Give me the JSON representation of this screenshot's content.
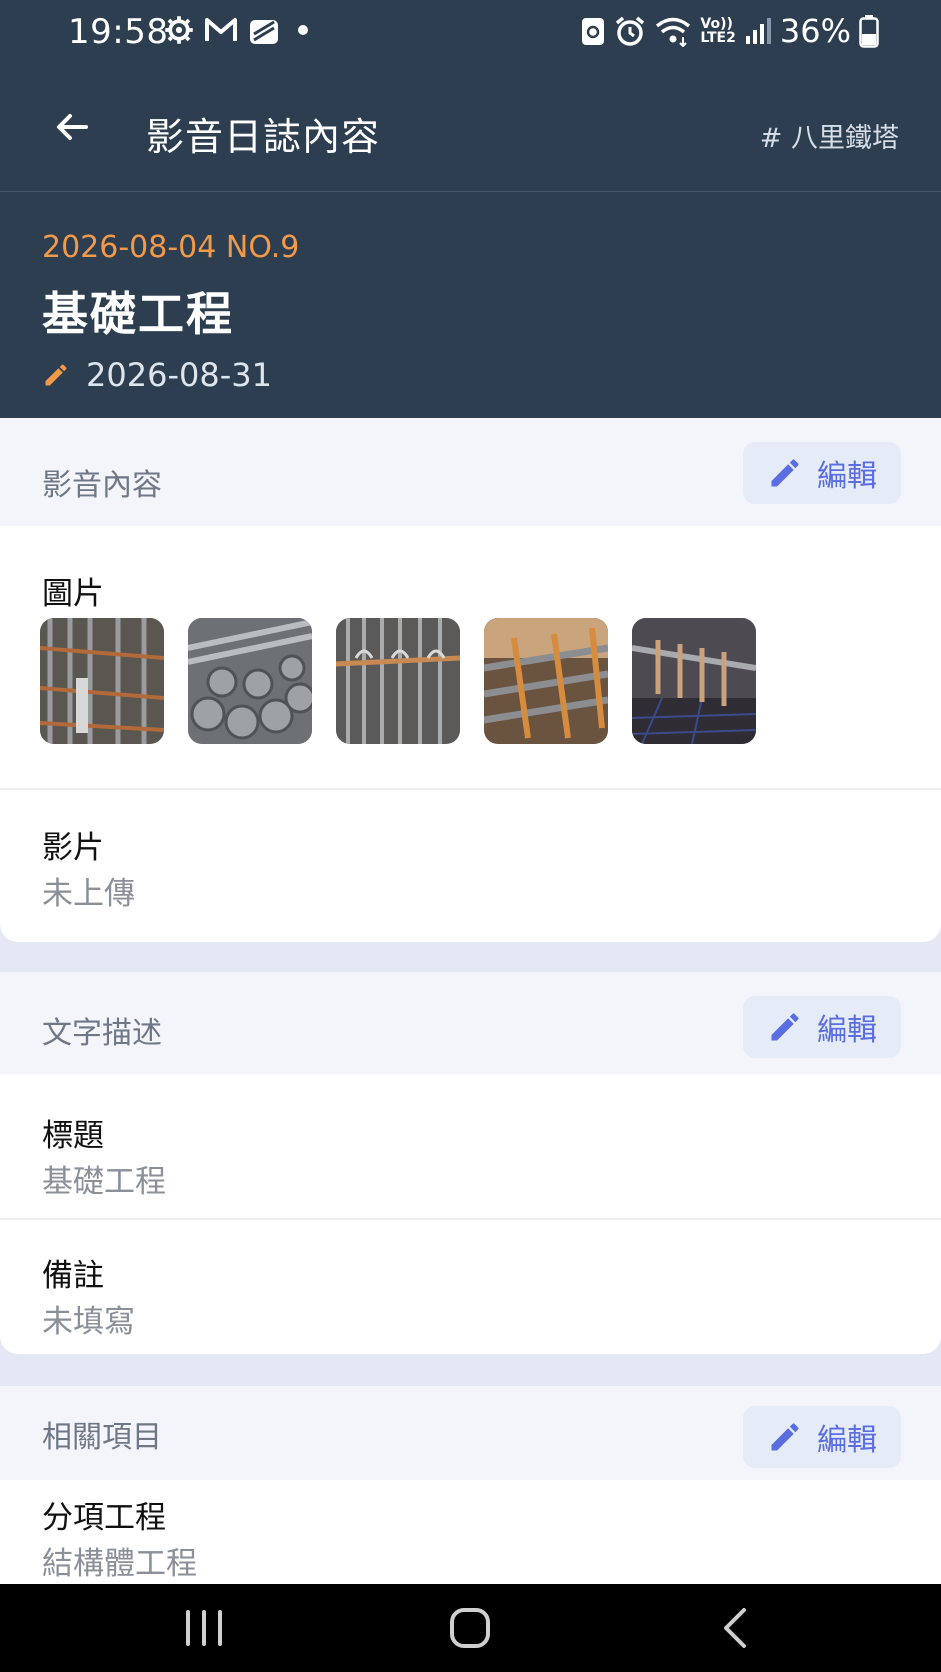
{
  "status_bar": {
    "time": "19:58",
    "battery": "36%",
    "left_icons": [
      "gear-icon",
      "gmail-icon",
      "app-icon",
      "dot-icon"
    ],
    "right_icons": [
      "recycle-icon",
      "alarm-icon",
      "wifi-icon",
      "volte-icon",
      "signal-icon",
      "battery-icon"
    ],
    "volte_label_top": "Vo))",
    "volte_label_bottom": "LTE2"
  },
  "app_bar": {
    "title": "影音日誌內容",
    "tag": "# 八里鐵塔"
  },
  "header": {
    "date_no": "2026-08-04 NO.9",
    "title": "基礎工程",
    "edit_date": "2026-08-31"
  },
  "sections": {
    "media": {
      "label": "影音內容",
      "edit_label": "編輯",
      "images_label": "圖片",
      "video_label": "影片",
      "video_value": "未上傳"
    },
    "text": {
      "label": "文字描述",
      "edit_label": "編輯",
      "title_label": "標題",
      "title_value": "基礎工程",
      "note_label": "備註",
      "note_value": "未填寫"
    },
    "related": {
      "label": "相關項目",
      "edit_label": "編輯",
      "sub_label": "分項工程",
      "sub_value": "結構體工程"
    }
  },
  "colors": {
    "header_bg": "#2d3e50",
    "accent_orange": "#f2994a",
    "edit_blue": "#5b6ee1"
  }
}
